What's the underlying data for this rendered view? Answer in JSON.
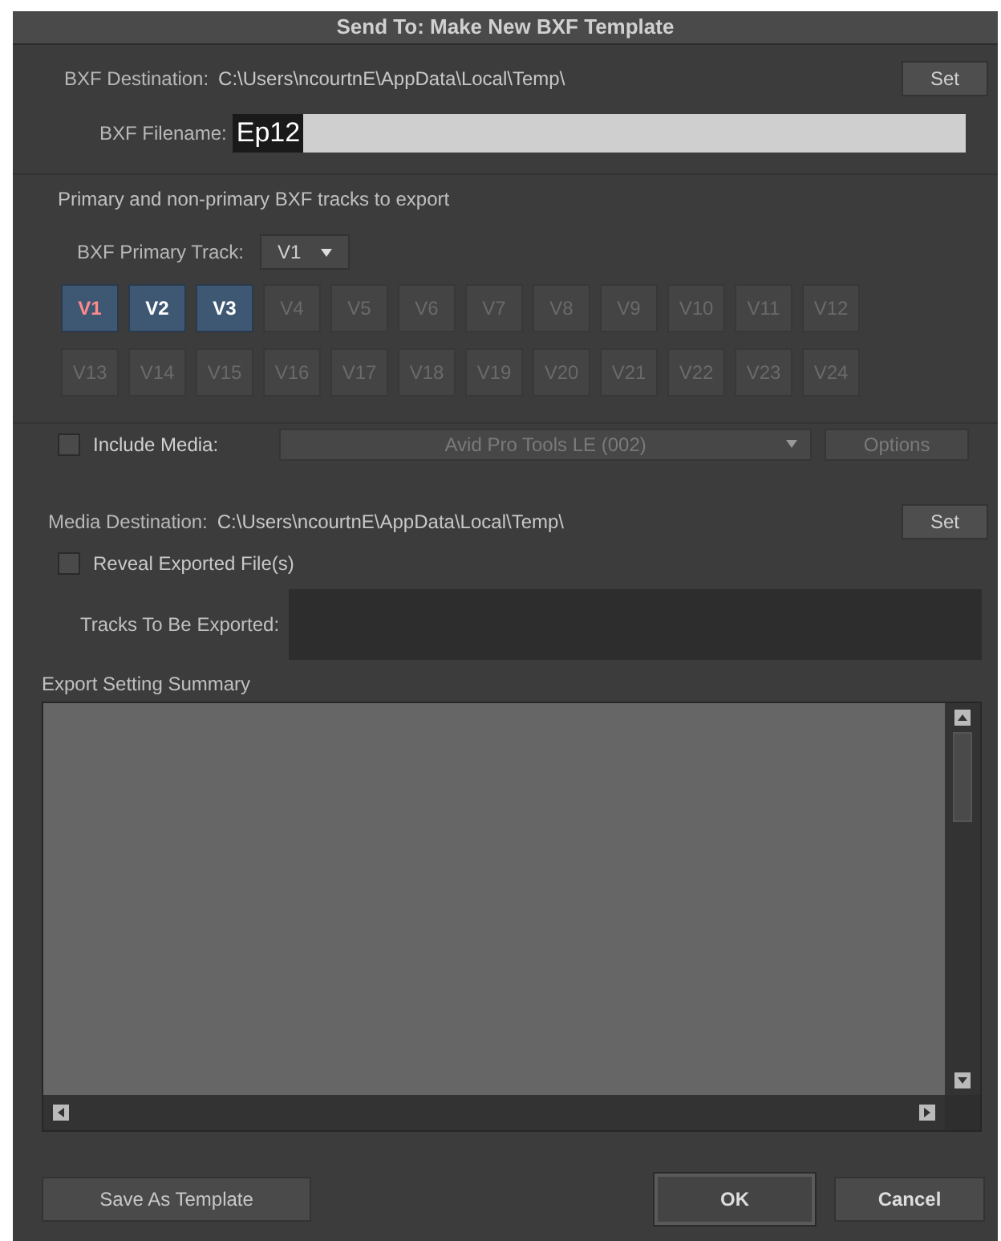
{
  "window": {
    "title": "Send To: Make New BXF Template"
  },
  "bxf_destination": {
    "label": "BXF Destination:",
    "path": "C:\\Users\\ncourtnE\\AppData\\Local\\Temp\\",
    "button": "Set"
  },
  "bxf_filename": {
    "label": "BXF Filename:",
    "value": "Ep12"
  },
  "tracks_heading": "Primary and non-primary BXF tracks to export",
  "primary_track": {
    "label": "BXF Primary Track:",
    "value": "V1"
  },
  "tracks": [
    {
      "label": "V1",
      "selected": true,
      "primary": true
    },
    {
      "label": "V2",
      "selected": true,
      "primary": false
    },
    {
      "label": "V3",
      "selected": true,
      "primary": false
    },
    {
      "label": "V4",
      "selected": false,
      "primary": false
    },
    {
      "label": "V5",
      "selected": false,
      "primary": false
    },
    {
      "label": "V6",
      "selected": false,
      "primary": false
    },
    {
      "label": "V7",
      "selected": false,
      "primary": false
    },
    {
      "label": "V8",
      "selected": false,
      "primary": false
    },
    {
      "label": "V9",
      "selected": false,
      "primary": false
    },
    {
      "label": "V10",
      "selected": false,
      "primary": false
    },
    {
      "label": "V11",
      "selected": false,
      "primary": false
    },
    {
      "label": "V12",
      "selected": false,
      "primary": false
    },
    {
      "label": "V13",
      "selected": false,
      "primary": false
    },
    {
      "label": "V14",
      "selected": false,
      "primary": false
    },
    {
      "label": "V15",
      "selected": false,
      "primary": false
    },
    {
      "label": "V16",
      "selected": false,
      "primary": false
    },
    {
      "label": "V17",
      "selected": false,
      "primary": false
    },
    {
      "label": "V18",
      "selected": false,
      "primary": false
    },
    {
      "label": "V19",
      "selected": false,
      "primary": false
    },
    {
      "label": "V20",
      "selected": false,
      "primary": false
    },
    {
      "label": "V21",
      "selected": false,
      "primary": false
    },
    {
      "label": "V22",
      "selected": false,
      "primary": false
    },
    {
      "label": "V23",
      "selected": false,
      "primary": false
    },
    {
      "label": "V24",
      "selected": false,
      "primary": false
    }
  ],
  "include_media": {
    "label": "Include Media:",
    "checked": false,
    "format": "Avid Pro Tools LE (002)",
    "options_button": "Options",
    "disabled": true
  },
  "media_destination": {
    "label": "Media Destination:",
    "path": "C:\\Users\\ncourtnE\\AppData\\Local\\Temp\\",
    "button": "Set"
  },
  "reveal_exported": {
    "label": "Reveal Exported File(s)",
    "checked": false
  },
  "tracks_to_export": {
    "label": "Tracks To Be Exported:"
  },
  "summary": {
    "label": "Export Setting Summary"
  },
  "buttons": {
    "save_template": "Save As Template",
    "ok": "OK",
    "cancel": "Cancel"
  }
}
